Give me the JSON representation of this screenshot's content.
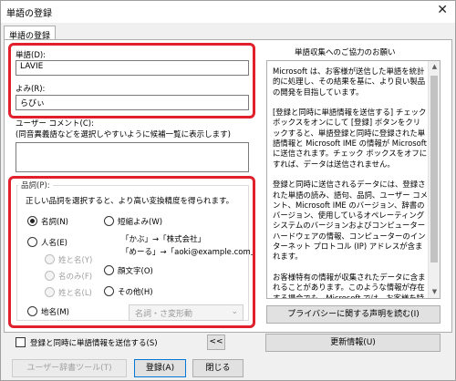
{
  "window": {
    "title": "単語の登録",
    "close_glyph": "✕"
  },
  "tab": {
    "label": "単語の登録"
  },
  "word": {
    "label": "単語(D):",
    "value": "LAVIE"
  },
  "reading": {
    "label": "よみ(R):",
    "value": "らびぃ"
  },
  "comment": {
    "label": "ユーザー コメント(C):",
    "hint": "(同音異義語などを選択しやすいように候補一覧に表示します)"
  },
  "pos": {
    "group_label": "品詞(P):",
    "hint": "正しい品詞を選択すると、より高い変換精度を得られます。",
    "options": {
      "noun": "名詞(N)",
      "person": "人名(E)",
      "surname_given": "姓と名(Y)",
      "given": "名のみ(F)",
      "surname": "姓と名(L)",
      "place": "地名(M)",
      "short_reading": "短縮よみ(W)",
      "emoticon": "顔文字(O)",
      "other": "その他(H)"
    },
    "example1": "「かぶ」→「株式会社」",
    "example2": "「めーる」→「aoki@example.com」",
    "verb_select": {
      "value": "名詞・さ変形動",
      "arrow": "⌄"
    }
  },
  "info": {
    "title": "単語収集へのご協力のお願い",
    "text": "Microsoft は、お客様が送信した単語を統計的に処理し、その結果を基に、より良い製品の開発を目指しています。\n\n[登録と同時に単語情報を送信する] チェック ボックスをオンにして [登録] ボタンをクリックすると、単語登録と同時に登録された単語情報と Microsoft IME の情報が Microsoft に送信されます。チェック ボックスをオフにすれば、データは送信されません。\n\n登録と同時に送信されるデータには、登録された単語の読み、語句、品詞、ユーザー コメント、Microsoft IME のバージョン、辞書のバージョン、使用しているオペレーティング システムのバージョンおよびコンピューター ハードウェアの情報、コンピューターのインターネット プロトコル (IP) アドレスが含まれます。\n\nお客様特有の情報が収集されたデータに含まれることがあります。このような情報が存在する場合でも、Microsoft では、お客様を特定するために情報を使用することはありません。",
    "scroll_up": "▲",
    "scroll_down": "▼"
  },
  "privacy_button": "プライバシーに関する声明を読む(I)",
  "send_checkbox": "登録と同時に単語情報を送信する(S)",
  "collapse_button": "<<",
  "update_button": "更新情報(U)",
  "footer": {
    "user_dict_tool": "ユーザー辞書ツール(T)",
    "register": "登録(A)",
    "close": "閉じる"
  }
}
